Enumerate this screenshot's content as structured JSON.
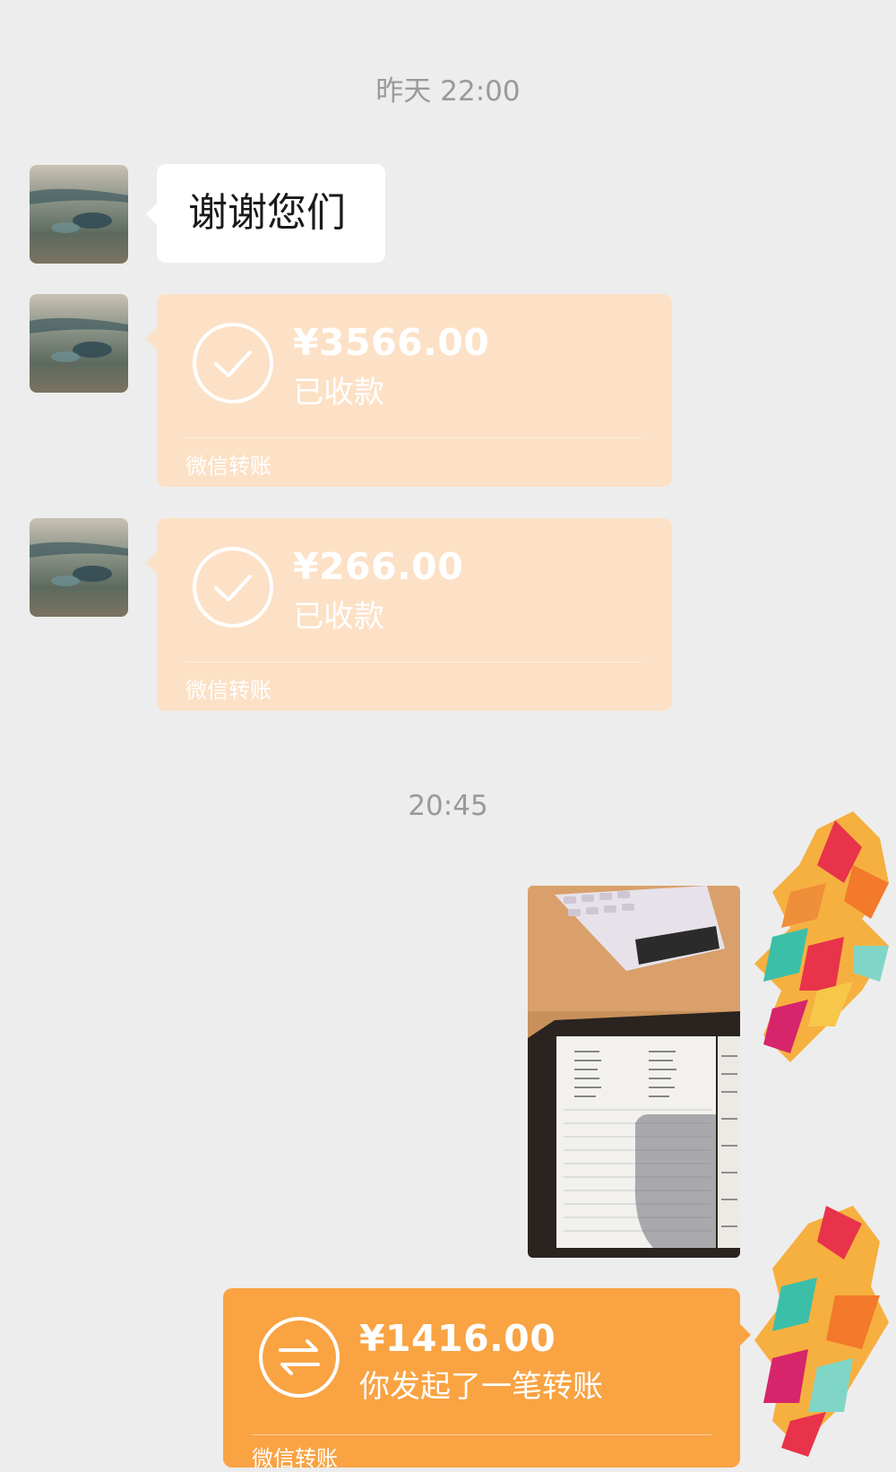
{
  "chat": {
    "timestamp_1": "昨天 22:00",
    "timestamp_2": "20:45",
    "text_message": "谢谢您们",
    "transfers": [
      {
        "amount": "¥3566.00",
        "status": "已收款",
        "label": "微信转账"
      },
      {
        "amount": "¥266.00",
        "status": "已收款",
        "label": "微信转账"
      },
      {
        "amount": "¥1416.00",
        "status": "你发起了一笔转账",
        "label": "微信转账"
      }
    ]
  },
  "colors": {
    "background": "#ededed",
    "received_transfer": "#fce1c6",
    "sent_transfer": "#f9a343",
    "text_bubble": "#ffffff",
    "timestamp": "#9a9a9a"
  },
  "icons": {
    "received": "check-circle-icon",
    "sent": "transfer-arrows-icon"
  }
}
